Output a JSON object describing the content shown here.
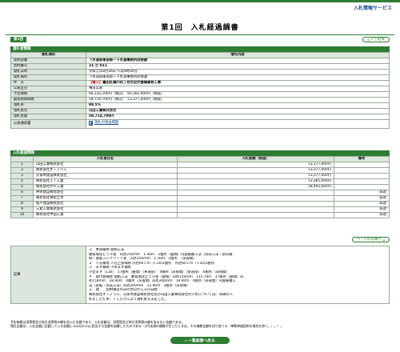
{
  "header": {
    "service_link": "入札情報サービス",
    "page_title": "第1回　入札経過調書",
    "round_badge": "第1回",
    "list_button": "くじ結果"
  },
  "info_section": {
    "heading": "落札者情報",
    "col_item": "落札項目",
    "col_content": "落札内容",
    "rows": [
      {
        "label": "契約部署",
        "value": "下水道局東部第一下水道事務所庶務課"
      },
      {
        "label": "契約番号",
        "value": "31-土-011"
      },
      {
        "label": "開札日時",
        "value": "令和元年8月26日 午前9時00分"
      },
      {
        "label": "開札場所",
        "value": "下水道局東部第一下水道事務所庶務課"
      },
      {
        "label": "件　名",
        "tag": "【電子】",
        "value": "墨田区横川四丁目付近外整備補修工事"
      },
      {
        "label": "公表区分",
        "value": "事前公表"
      },
      {
        "label": "予定価格",
        "value": "66,332,200円（税込）　60,302,000円（税抜）"
      },
      {
        "label": "最低制限価格",
        "value": "58,714,700円（税込）　53,377,000円（税抜）"
      },
      {
        "label": "落札率",
        "value": "88.5%"
      },
      {
        "label": "落札者名",
        "value": "山田工業株式会社"
      },
      {
        "label": "落札金額",
        "value": "58,714,700円"
      }
    ],
    "notice_label": "公表通知書",
    "notice_link": "落札の理由標題"
  },
  "bid_section": {
    "heading": "入札経過情報",
    "col_company": "入札者氏名",
    "col_amount": "入札金額（税抜）",
    "col_note": "備考",
    "rows": [
      {
        "no": "1",
        "company": "山田工業株式会社",
        "amount": "53,377,000円",
        "note": ""
      },
      {
        "no": "2",
        "company": "株式会社オープラス",
        "amount": "53,377,000円",
        "note": ""
      },
      {
        "no": "3",
        "company": "久保木建設株式会社",
        "amount": "53,377,000円",
        "note": ""
      },
      {
        "no": "4",
        "company": "株式会社ＩＴ工業",
        "amount": "53,385,000円",
        "note": ""
      },
      {
        "no": "5",
        "company": "株式会社ＭＫ工業",
        "amount": "58,492,000円",
        "note": ""
      },
      {
        "no": "6",
        "company": "神栄建設株式会社",
        "amount": "",
        "note": "辞退"
      },
      {
        "no": "7",
        "company": "株式会社株松土木",
        "amount": "",
        "note": "辞退"
      },
      {
        "no": "8",
        "company": "松戸建設株式会社",
        "amount": "",
        "note": "辞退"
      },
      {
        "no": "9",
        "company": "三倉工業株式会社",
        "amount": "",
        "note": "辞退"
      },
      {
        "no": "10",
        "company": "株式会社中田工業",
        "amount": "",
        "note": "辞退"
      }
    ],
    "page_top_button": "ページの先頭へ"
  },
  "remarks": {
    "label": "記事",
    "lines": [
      "１　本管補修 開削工法",
      "硬質塩化ビニル管　内径250ｍｍ　1.40ｍ　2箇所（昼間）内面被覆工法（形成工法・部分補",
      "修）鉄筋コンクリート管　内径350ｍｍ　1.50ｍ　2箇所　（深夜間）",
      "２　人孔補修 人孔上部補修 内径60ｃｍ（T-20)1箇所　内径60ｃｍ（T-20)1箇所",
      "３　ます補修 汚水ます補修",
      "小型ます（L30）　57箇所（昼間）（車道部）　4箇所（深夜間）（歩道部）　6箇所（深夜間）",
      "４　取付管補修 開削工法　硬質塩化ビニル管（昼間）内径150ｍｍ　115.70ｍ　37箇所（昼間）内",
      "径150ｍｍ　18.90ｍ　4箇所（深夜間）内径200ｍｍ　19.00ｍ　4箇所（深夜間）内面被覆工",
      "法（反転・形成工法）内径200ｍｍ　12.90ｍ　3箇所（深夜間）",
      "工　期　　契約確定の日の翌日から115日間",
      "株式会社オープラス、久保木建設株式会社及び山田工業株式会社の入札については、同価の入",
      "札をしたため、くじ引きにより落札者を決定した。"
    ]
  },
  "footnotes": [
    "予定価格は消費税及び地方消費税の額を含んだ金額であり、入札金額は、消費税及び地方消費税の額を含まない金額である。",
    "落札金額は、入札金額に記載している金額に100分の10に相当する金額を加算したものである（1円未満の端数が生じたときは、その端数金額を切り捨てる（単数単価契約の場合を除く。）。）。"
  ],
  "back_button": "一覧画面へ戻る"
}
